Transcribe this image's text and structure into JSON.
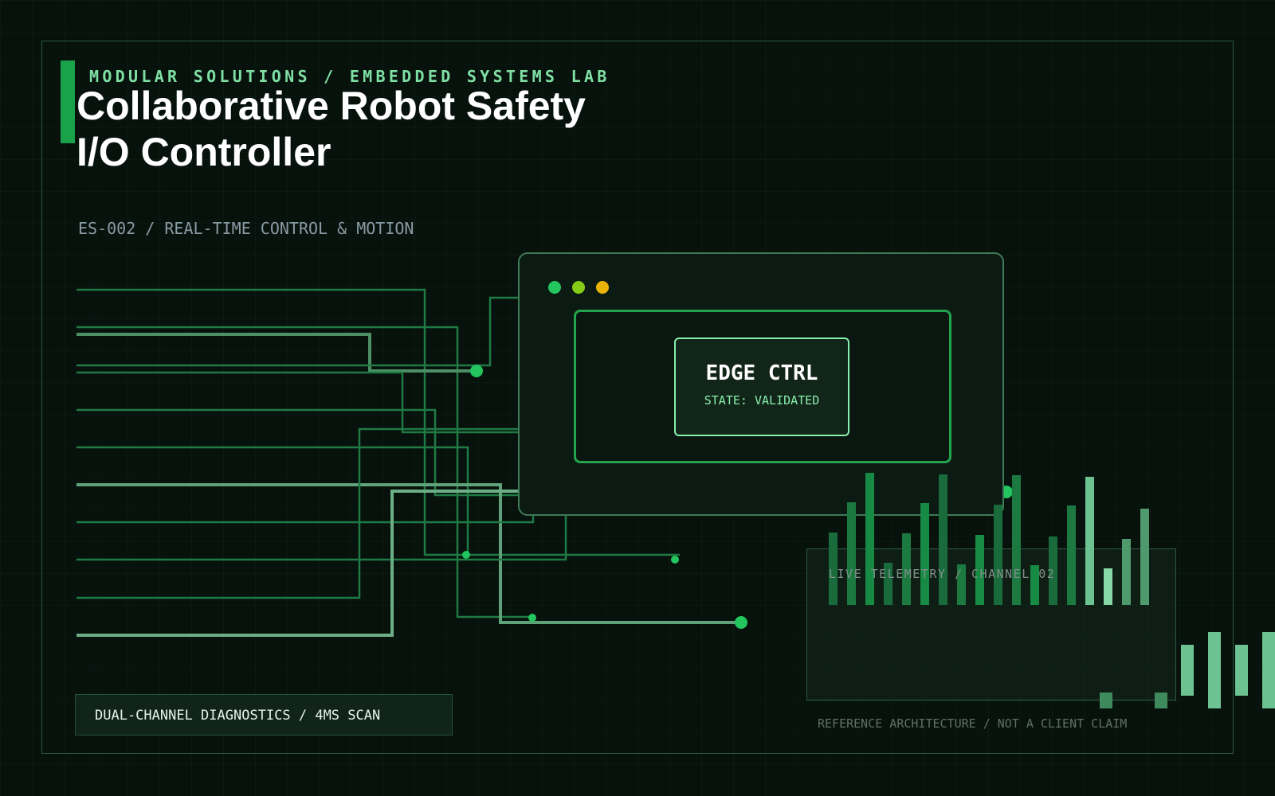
{
  "header": {
    "kicker": "MODULAR SOLUTIONS / EMBEDDED SYSTEMS LAB",
    "title_line1": "Collaborative Robot Safety",
    "title_line2": "I/O Controller",
    "subtitle": "ES-002 / REAL-TIME CONTROL & MOTION"
  },
  "window": {
    "badge_title": "EDGE CTRL",
    "badge_state": "STATE: VALIDATED",
    "dot_colors": [
      "#22c55e",
      "#84cc16",
      "#eab308"
    ]
  },
  "telemetry": {
    "label": "LIVE TELEMETRY / CHANNEL 02",
    "levels": [
      0.55,
      0.78,
      1.0,
      0.32,
      0.54,
      0.77,
      0.99,
      0.31,
      0.53,
      0.76,
      0.98,
      0.3,
      0.52,
      0.75,
      0.97,
      0.28,
      0.5,
      0.73
    ]
  },
  "diagnostics": {
    "label": "DUAL-CHANNEL DIAGNOSTICS / 4MS SCAN"
  },
  "footnote": "REFERENCE ARCHITECTURE / NOT A CLIENT CLAIM",
  "colors": {
    "accent": "#22c55e",
    "accent_light": "#86efac",
    "background": "#07120d"
  }
}
